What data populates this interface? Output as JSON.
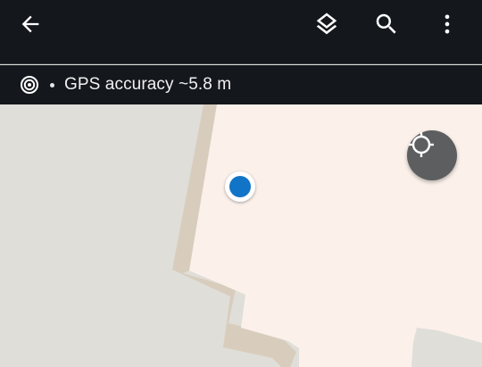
{
  "toolbar": {
    "back_icon": "arrow-back-icon",
    "layers_icon": "layers-icon",
    "search_icon": "search-icon",
    "more_icon": "more-vert-icon"
  },
  "status": {
    "gps_icon": "gps-target-icon",
    "gps_text": "GPS accuracy ~5.8 m"
  },
  "map": {
    "recenter_icon": "crosshair-icon",
    "location_marker": "current-location-marker"
  },
  "colors": {
    "toolbar_bg": "#14171c",
    "map_bg": "#dfded9",
    "building_fill": "#fbf0ea",
    "building_edge": "#d8cdbd",
    "location_blue": "#1274c6",
    "fab_bg": "#5d5e5f"
  }
}
